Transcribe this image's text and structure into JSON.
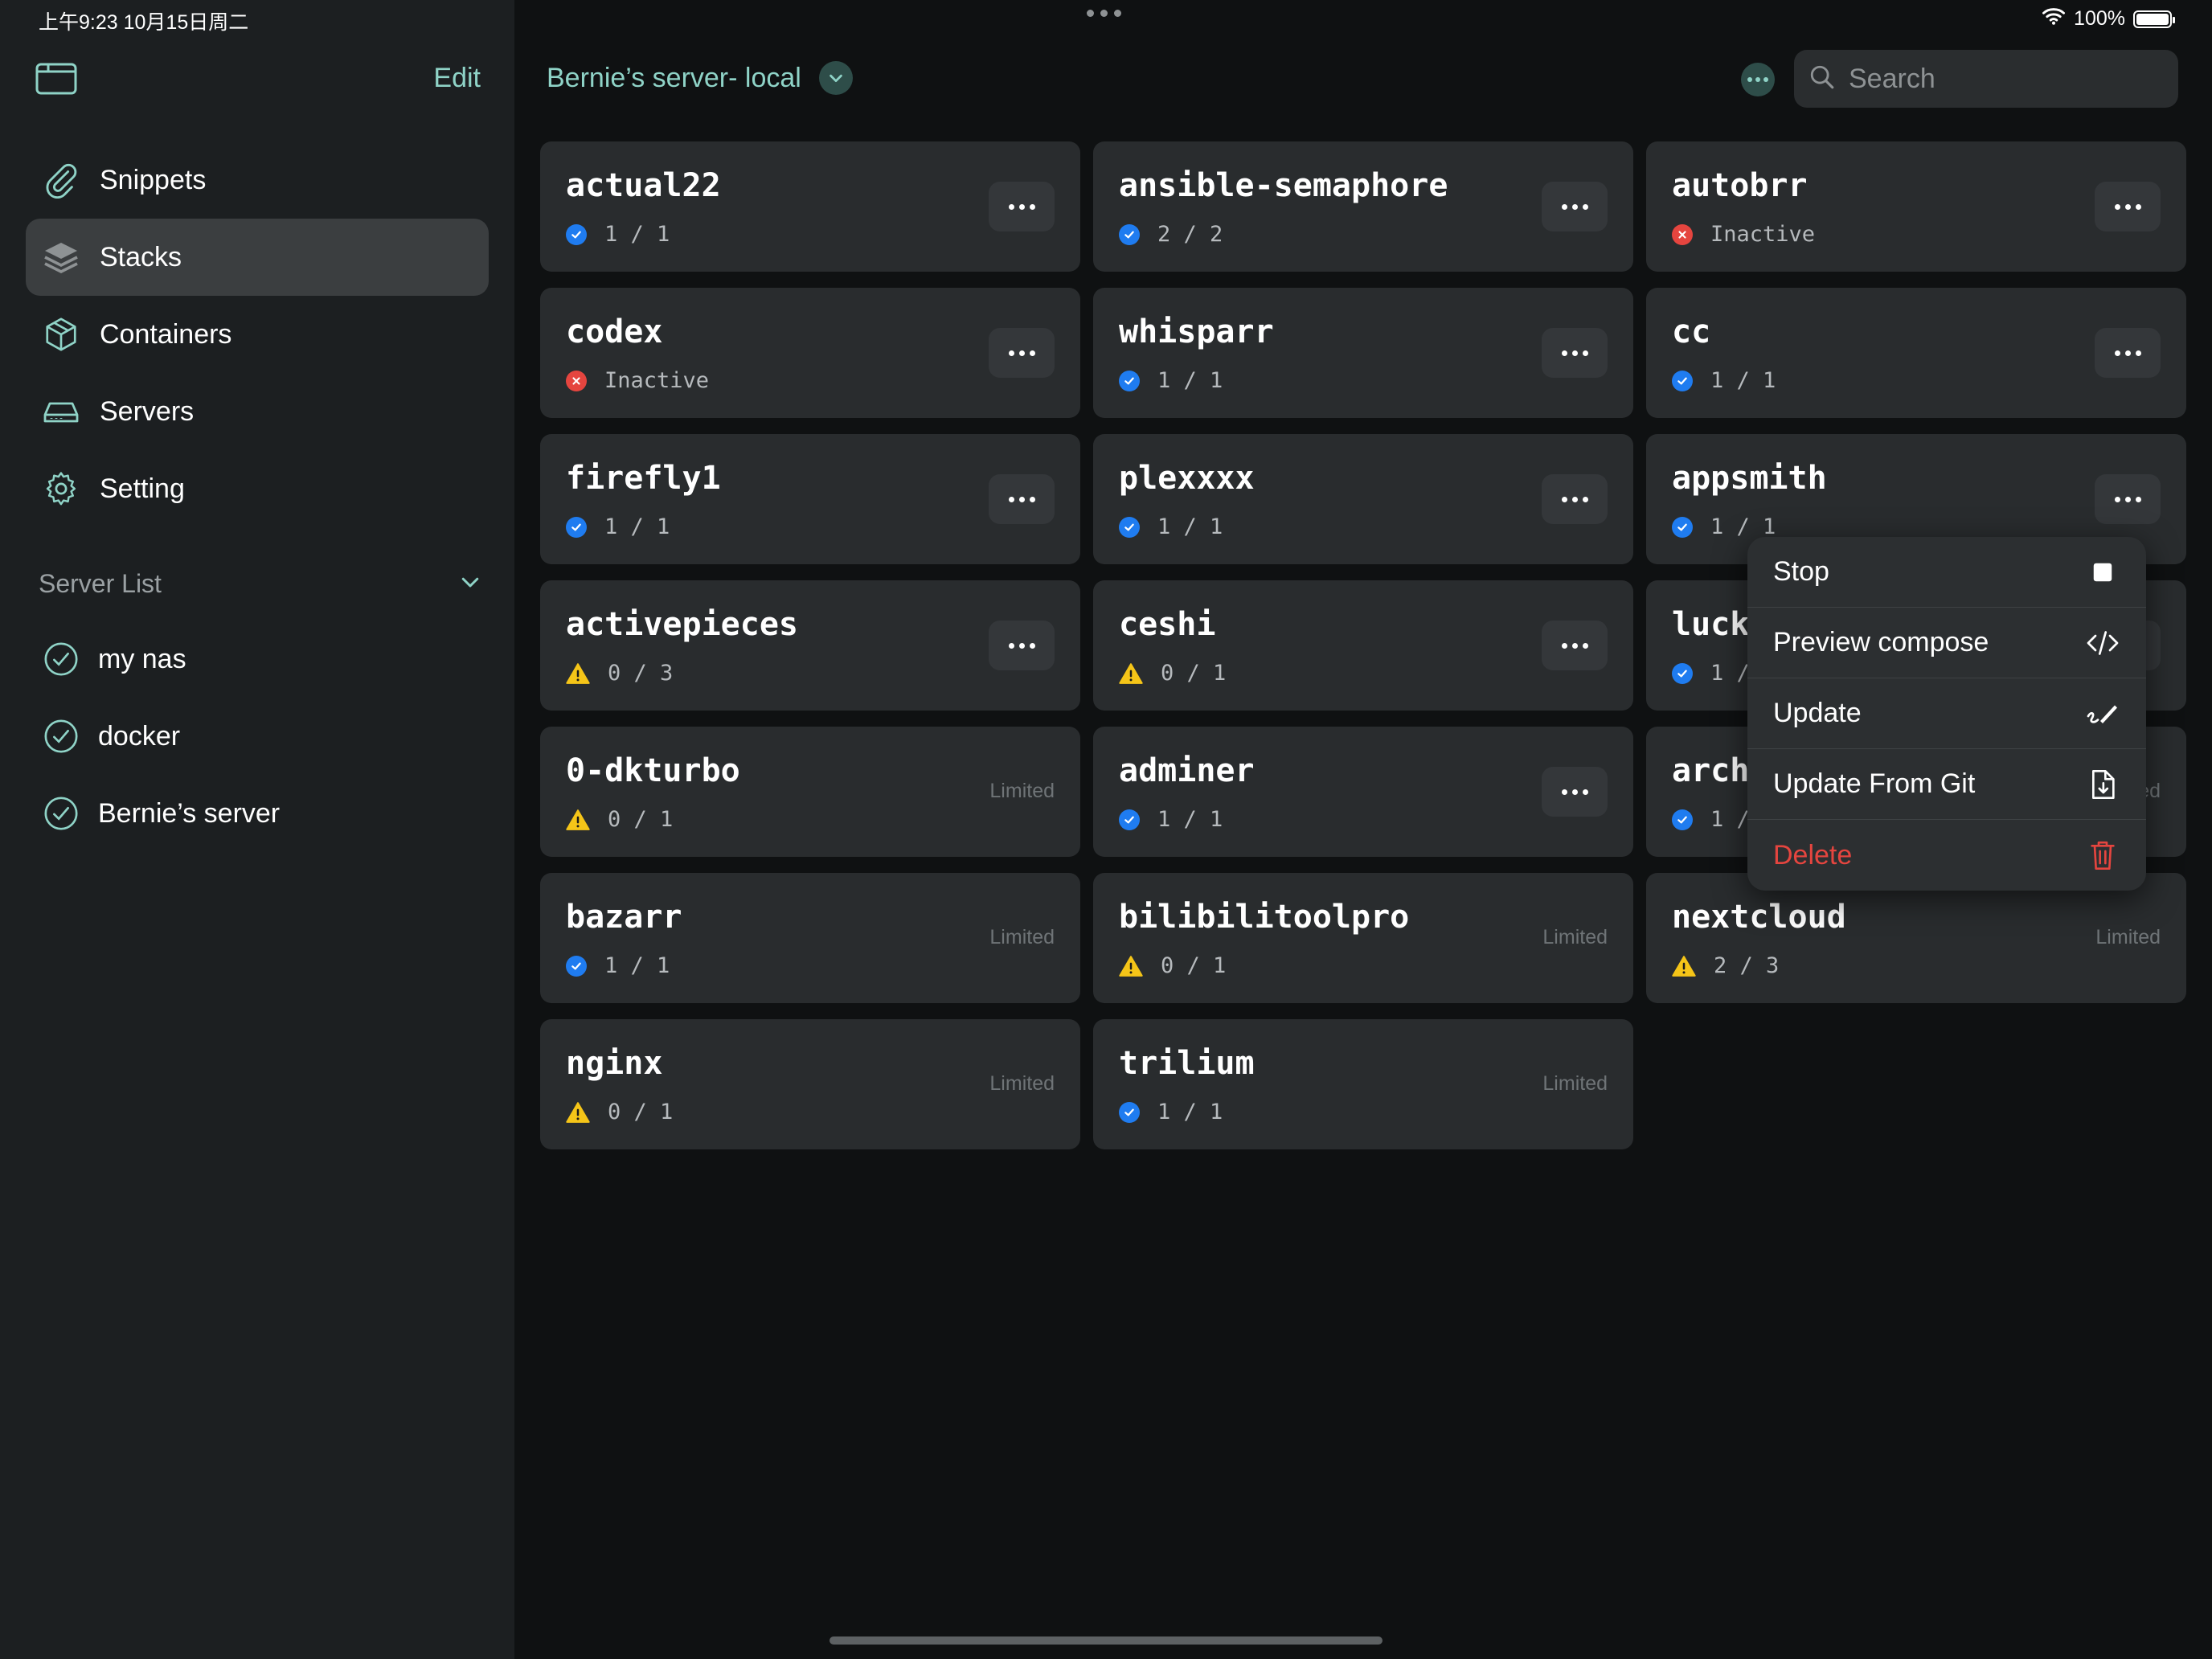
{
  "status_bar": {
    "time": "上午9:23  10月15日周二",
    "battery": "100%"
  },
  "sidebar": {
    "edit_label": "Edit",
    "nav": [
      {
        "label": "Snippets",
        "icon": "paperclip-icon"
      },
      {
        "label": "Stacks",
        "icon": "layers-icon",
        "active": true
      },
      {
        "label": "Containers",
        "icon": "cube-icon"
      },
      {
        "label": "Servers",
        "icon": "server-drive-icon"
      },
      {
        "label": "Setting",
        "icon": "gear-icon"
      }
    ],
    "server_list_title": "Server List",
    "servers": [
      "my nas",
      "docker",
      "Bernie’s server"
    ]
  },
  "header": {
    "server_title": "Bernie’s server- local",
    "search_placeholder": "Search"
  },
  "stacks": [
    {
      "name": "actual22",
      "status": "ok",
      "count": "1 / 1",
      "limited": ""
    },
    {
      "name": "ansible-semaphore",
      "status": "ok",
      "count": "2 / 2",
      "limited": ""
    },
    {
      "name": "autobrr",
      "status": "error",
      "count": "Inactive",
      "limited": ""
    },
    {
      "name": "codex",
      "status": "error",
      "count": "Inactive",
      "limited": ""
    },
    {
      "name": "whisparr",
      "status": "ok",
      "count": "1 / 1",
      "limited": ""
    },
    {
      "name": "cc",
      "status": "ok",
      "count": "1 / 1",
      "limited": ""
    },
    {
      "name": "firefly1",
      "status": "ok",
      "count": "1 / 1",
      "limited": ""
    },
    {
      "name": "plexxxx",
      "status": "ok",
      "count": "1 / 1",
      "limited": ""
    },
    {
      "name": "appsmith",
      "status": "ok",
      "count": "1 / 1",
      "limited": ""
    },
    {
      "name": "activepieces",
      "status": "warning",
      "count": "0 / 3",
      "limited": ""
    },
    {
      "name": "ceshi",
      "status": "warning",
      "count": "0 / 1",
      "limited": ""
    },
    {
      "name": "lucky",
      "status": "ok",
      "count": "1 / 1",
      "limited": ""
    },
    {
      "name": "0-dkturbo",
      "status": "warning",
      "count": "0 / 1",
      "limited": "Limited"
    },
    {
      "name": "adminer",
      "status": "ok",
      "count": "1 / 1",
      "limited": ""
    },
    {
      "name": "archivebox",
      "status": "ok",
      "count": "1 / 1",
      "limited": "Limited"
    },
    {
      "name": "bazarr",
      "status": "ok",
      "count": "1 / 1",
      "limited": "Limited"
    },
    {
      "name": "bilibilitoolpro",
      "status": "warning",
      "count": "0 / 1",
      "limited": "Limited"
    },
    {
      "name": "nextcloud",
      "status": "warning",
      "count": "2 / 3",
      "limited": "Limited"
    },
    {
      "name": "nginx",
      "status": "warning",
      "count": "0 / 1",
      "limited": "Limited"
    },
    {
      "name": "trilium",
      "status": "ok",
      "count": "1 / 1",
      "limited": "Limited"
    }
  ],
  "context_menu": {
    "items": [
      {
        "label": "Stop",
        "icon": "stop-square-icon"
      },
      {
        "label": "Preview compose",
        "icon": "code-brackets-icon"
      },
      {
        "label": "Update",
        "icon": "pencil-scribble-icon"
      },
      {
        "label": "Update From Git",
        "icon": "document-download-icon"
      },
      {
        "label": "Delete",
        "icon": "trash-icon",
        "danger": true
      }
    ]
  },
  "colors": {
    "accent": "#8fd3c7",
    "ok": "#1f7cf0",
    "error": "#e5453f",
    "warning": "#f5c518"
  }
}
